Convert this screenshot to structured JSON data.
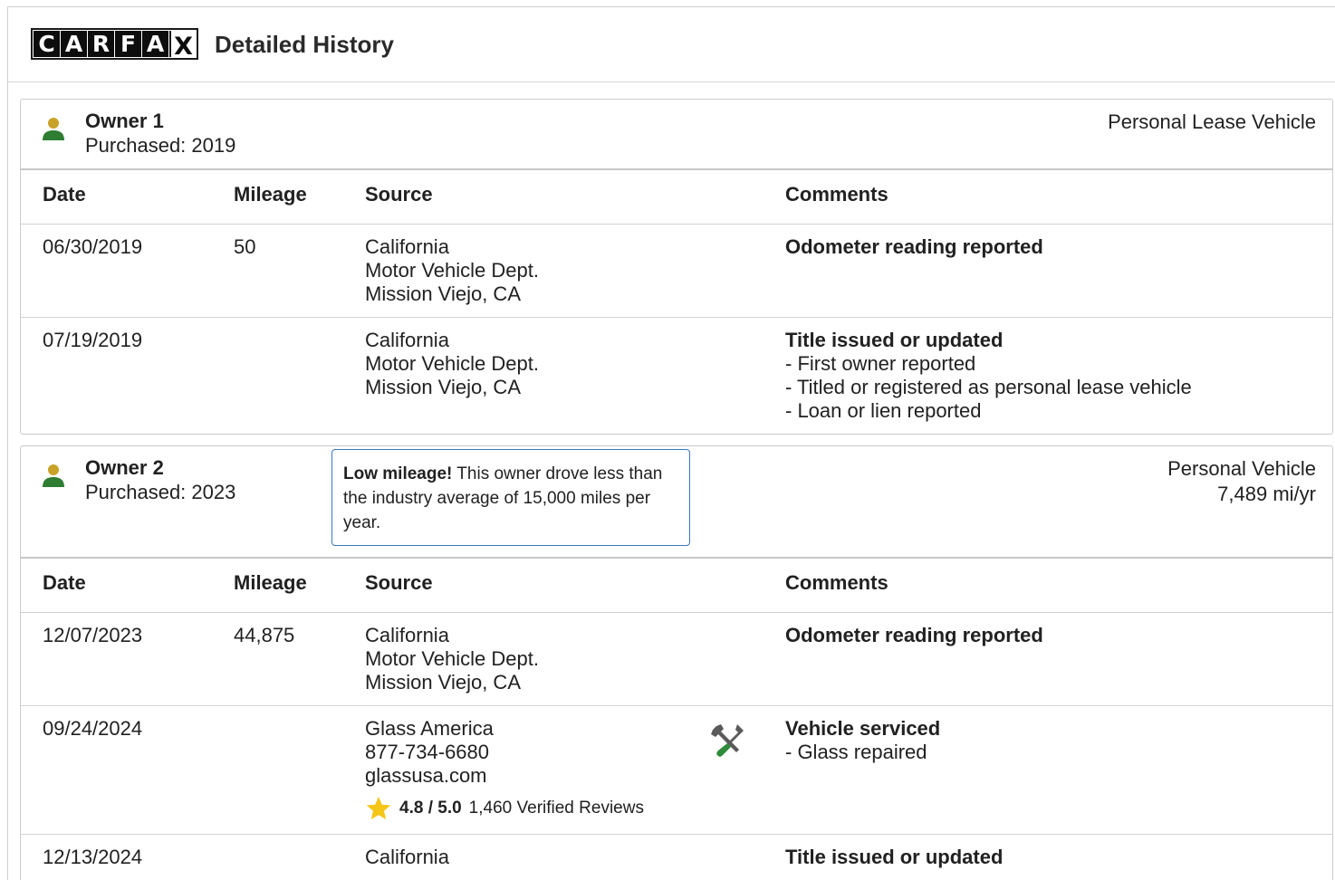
{
  "header": {
    "logo_letters": [
      "C",
      "A",
      "R",
      "F",
      "A",
      "X"
    ],
    "title": "Detailed History"
  },
  "colors": {
    "person_head": "#c9a227",
    "person_body": "#2e7d32",
    "callout_border": "#3b77c4",
    "star": "#f5c518",
    "tool_green": "#2e8b3a"
  },
  "columns": {
    "date": "Date",
    "mileage": "Mileage",
    "source": "Source",
    "comments": "Comments"
  },
  "owners": [
    {
      "name": "Owner 1",
      "purchased": "Purchased: 2019",
      "type": "Personal Lease Vehicle",
      "rows": [
        {
          "date": "06/30/2019",
          "mileage": "50",
          "source": [
            "California",
            "Motor Vehicle Dept.",
            "Mission Viejo, CA"
          ],
          "comment_title": "Odometer reading reported",
          "comment_items": []
        },
        {
          "date": "07/19/2019",
          "mileage": "",
          "source": [
            "California",
            "Motor Vehicle Dept.",
            "Mission Viejo, CA"
          ],
          "comment_title": "Title issued or updated",
          "comment_items": [
            "- First owner reported",
            "- Titled or registered as personal lease vehicle",
            "- Loan or lien reported"
          ]
        }
      ]
    },
    {
      "name": "Owner 2",
      "purchased": "Purchased: 2023",
      "type": "Personal Vehicle",
      "mileage_rate": "7,489 mi/yr",
      "callout": {
        "bold": "Low mileage!",
        "text": " This owner drove less than the industry average of 15,000 miles per year."
      },
      "rows": [
        {
          "date": "12/07/2023",
          "mileage": "44,875",
          "source": [
            "California",
            "Motor Vehicle Dept.",
            "Mission Viejo, CA"
          ],
          "comment_title": "Odometer reading reported",
          "comment_items": []
        },
        {
          "date": "09/24/2024",
          "mileage": "",
          "source": [
            "Glass America",
            "877-734-6680",
            "glassusa.com"
          ],
          "rating_score": "4.8 / 5.0",
          "rating_reviews": "1,460 Verified Reviews",
          "icon": "wrench-screwdriver-icon",
          "comment_title": "Vehicle serviced",
          "comment_items": [
            "- Glass repaired"
          ]
        },
        {
          "date": "12/13/2024",
          "mileage": "",
          "source": [
            "California"
          ],
          "comment_title": "Title issued or updated",
          "comment_items": []
        }
      ]
    }
  ]
}
